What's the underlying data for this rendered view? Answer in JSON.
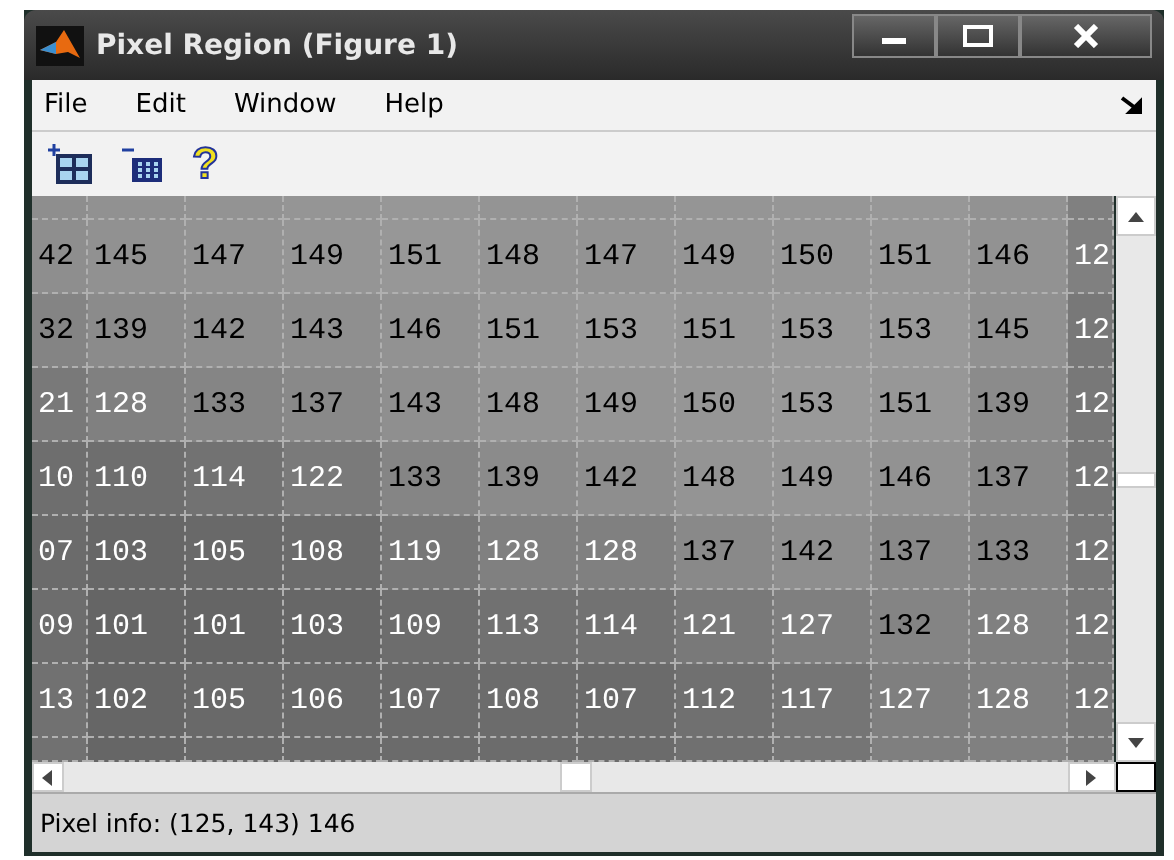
{
  "window": {
    "title": "Pixel Region (Figure 1)"
  },
  "menu": [
    "File",
    "Edit",
    "Window",
    "Help"
  ],
  "toolbar": {
    "help_glyph": "?"
  },
  "grid": [
    {
      "cells": [
        {
          "text": "42",
          "color": "#8e8e8e"
        },
        {
          "text": "145",
          "color": "#919191"
        },
        {
          "text": "147",
          "color": "#939393"
        },
        {
          "text": "149",
          "color": "#959595"
        },
        {
          "text": "151",
          "color": "#979797"
        },
        {
          "text": "148",
          "color": "#949494"
        },
        {
          "text": "147",
          "color": "#939393"
        },
        {
          "text": "149",
          "color": "#959595"
        },
        {
          "text": "150",
          "color": "#969696"
        },
        {
          "text": "151",
          "color": "#979797"
        },
        {
          "text": "146",
          "color": "#929292"
        },
        {
          "text": "12",
          "color": "#808080"
        }
      ]
    },
    {
      "cells": [
        {
          "text": "32",
          "color": "#848484"
        },
        {
          "text": "139",
          "color": "#8b8b8b"
        },
        {
          "text": "142",
          "color": "#8e8e8e"
        },
        {
          "text": "143",
          "color": "#8f8f8f"
        },
        {
          "text": "146",
          "color": "#929292"
        },
        {
          "text": "151",
          "color": "#979797"
        },
        {
          "text": "153",
          "color": "#999999"
        },
        {
          "text": "151",
          "color": "#979797"
        },
        {
          "text": "153",
          "color": "#999999"
        },
        {
          "text": "153",
          "color": "#999999"
        },
        {
          "text": "145",
          "color": "#919191"
        },
        {
          "text": "12",
          "color": "#787878"
        }
      ]
    },
    {
      "cells": [
        {
          "text": "21",
          "color": "#797979"
        },
        {
          "text": "128",
          "color": "#808080"
        },
        {
          "text": "133",
          "color": "#858585"
        },
        {
          "text": "137",
          "color": "#898989"
        },
        {
          "text": "143",
          "color": "#8f8f8f"
        },
        {
          "text": "148",
          "color": "#949494"
        },
        {
          "text": "149",
          "color": "#959595"
        },
        {
          "text": "150",
          "color": "#969696"
        },
        {
          "text": "153",
          "color": "#999999"
        },
        {
          "text": "151",
          "color": "#979797"
        },
        {
          "text": "139",
          "color": "#8b8b8b"
        },
        {
          "text": "12",
          "color": "#787878"
        }
      ]
    },
    {
      "cells": [
        {
          "text": "10",
          "color": "#6e6e6e"
        },
        {
          "text": "110",
          "color": "#6e6e6e"
        },
        {
          "text": "114",
          "color": "#727272"
        },
        {
          "text": "122",
          "color": "#7a7a7a"
        },
        {
          "text": "133",
          "color": "#858585"
        },
        {
          "text": "139",
          "color": "#8b8b8b"
        },
        {
          "text": "142",
          "color": "#8e8e8e"
        },
        {
          "text": "148",
          "color": "#949494"
        },
        {
          "text": "149",
          "color": "#959595"
        },
        {
          "text": "146",
          "color": "#929292"
        },
        {
          "text": "137",
          "color": "#898989"
        },
        {
          "text": "12",
          "color": "#787878"
        }
      ]
    },
    {
      "cells": [
        {
          "text": "07",
          "color": "#6b6b6b"
        },
        {
          "text": "103",
          "color": "#676767"
        },
        {
          "text": "105",
          "color": "#696969"
        },
        {
          "text": "108",
          "color": "#6c6c6c"
        },
        {
          "text": "119",
          "color": "#777777"
        },
        {
          "text": "128",
          "color": "#808080"
        },
        {
          "text": "128",
          "color": "#808080"
        },
        {
          "text": "137",
          "color": "#898989"
        },
        {
          "text": "142",
          "color": "#8e8e8e"
        },
        {
          "text": "137",
          "color": "#898989"
        },
        {
          "text": "133",
          "color": "#858585"
        },
        {
          "text": "12",
          "color": "#787878"
        }
      ]
    },
    {
      "cells": [
        {
          "text": "09",
          "color": "#6d6d6d"
        },
        {
          "text": "101",
          "color": "#656565"
        },
        {
          "text": "101",
          "color": "#656565"
        },
        {
          "text": "103",
          "color": "#676767"
        },
        {
          "text": "109",
          "color": "#6d6d6d"
        },
        {
          "text": "113",
          "color": "#717171"
        },
        {
          "text": "114",
          "color": "#727272"
        },
        {
          "text": "121",
          "color": "#797979"
        },
        {
          "text": "127",
          "color": "#7f7f7f"
        },
        {
          "text": "132",
          "color": "#848484"
        },
        {
          "text": "128",
          "color": "#808080"
        },
        {
          "text": "12",
          "color": "#787878"
        }
      ]
    },
    {
      "cells": [
        {
          "text": "13",
          "color": "#717171"
        },
        {
          "text": "102",
          "color": "#666666"
        },
        {
          "text": "105",
          "color": "#696969"
        },
        {
          "text": "106",
          "color": "#6a6a6a"
        },
        {
          "text": "107",
          "color": "#6b6b6b"
        },
        {
          "text": "108",
          "color": "#6c6c6c"
        },
        {
          "text": "107",
          "color": "#6b6b6b"
        },
        {
          "text": "112",
          "color": "#707070"
        },
        {
          "text": "117",
          "color": "#757575"
        },
        {
          "text": "127",
          "color": "#7f7f7f"
        },
        {
          "text": "128",
          "color": "#808080"
        },
        {
          "text": "12",
          "color": "#787878"
        }
      ]
    }
  ],
  "status_bar": "Pixel info: (125, 143)  146"
}
